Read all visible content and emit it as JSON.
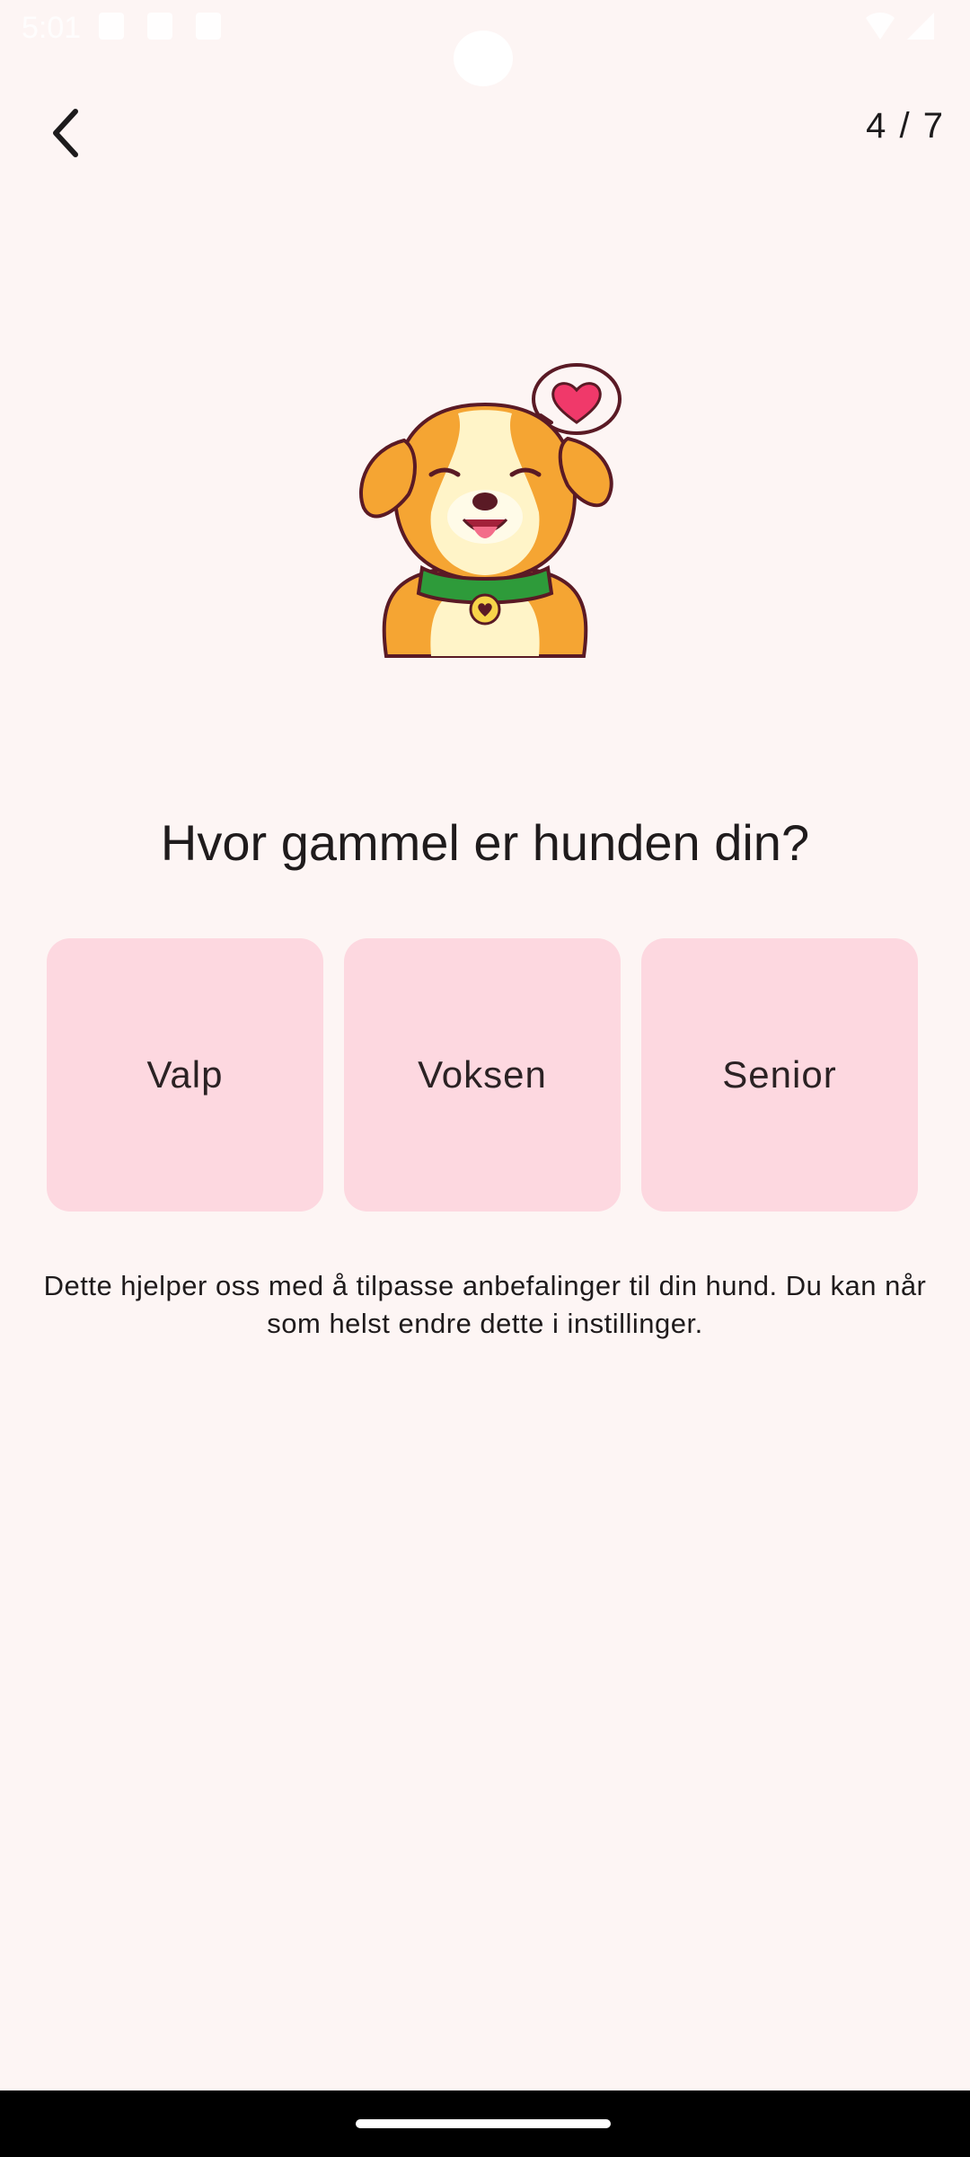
{
  "status_bar": {
    "time": "5:01"
  },
  "header": {
    "back_icon": "chevron-left-icon",
    "step_counter": "4 / 7"
  },
  "illustration": {
    "icon": "dog-with-heart-illustration"
  },
  "question": "Hvor gammel er hunden din?",
  "options": [
    {
      "label": "Valp"
    },
    {
      "label": "Voksen"
    },
    {
      "label": "Senior"
    }
  ],
  "helper_text": "Dette hjelper oss med å tilpasse anbefalinger til din hund. Du kan når som helst endre dette i instillinger.",
  "colors": {
    "background": "#fdf5f4",
    "option_card": "#fdd8e0",
    "text": "#1f1b1c",
    "heart": "#f0396a",
    "collar": "#2e9b3a"
  }
}
